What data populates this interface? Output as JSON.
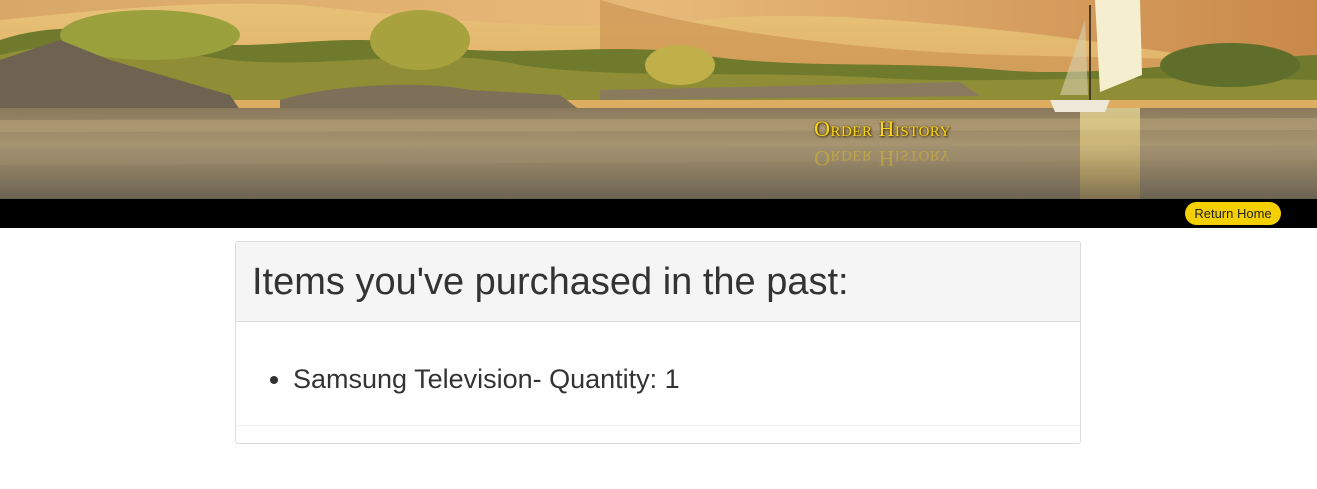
{
  "banner": {
    "title": "Order History",
    "image": "nile-river-felucca-landscape"
  },
  "navbar": {
    "return_home_label": "Return Home"
  },
  "orders": {
    "heading": "Items you've purchased in the past:",
    "items": [
      {
        "text": "Samsung Television- Quantity: 1"
      }
    ]
  },
  "colors": {
    "accent": "#f5d000",
    "navbar_bg": "#000000",
    "title_gold": "#f7d51a"
  }
}
